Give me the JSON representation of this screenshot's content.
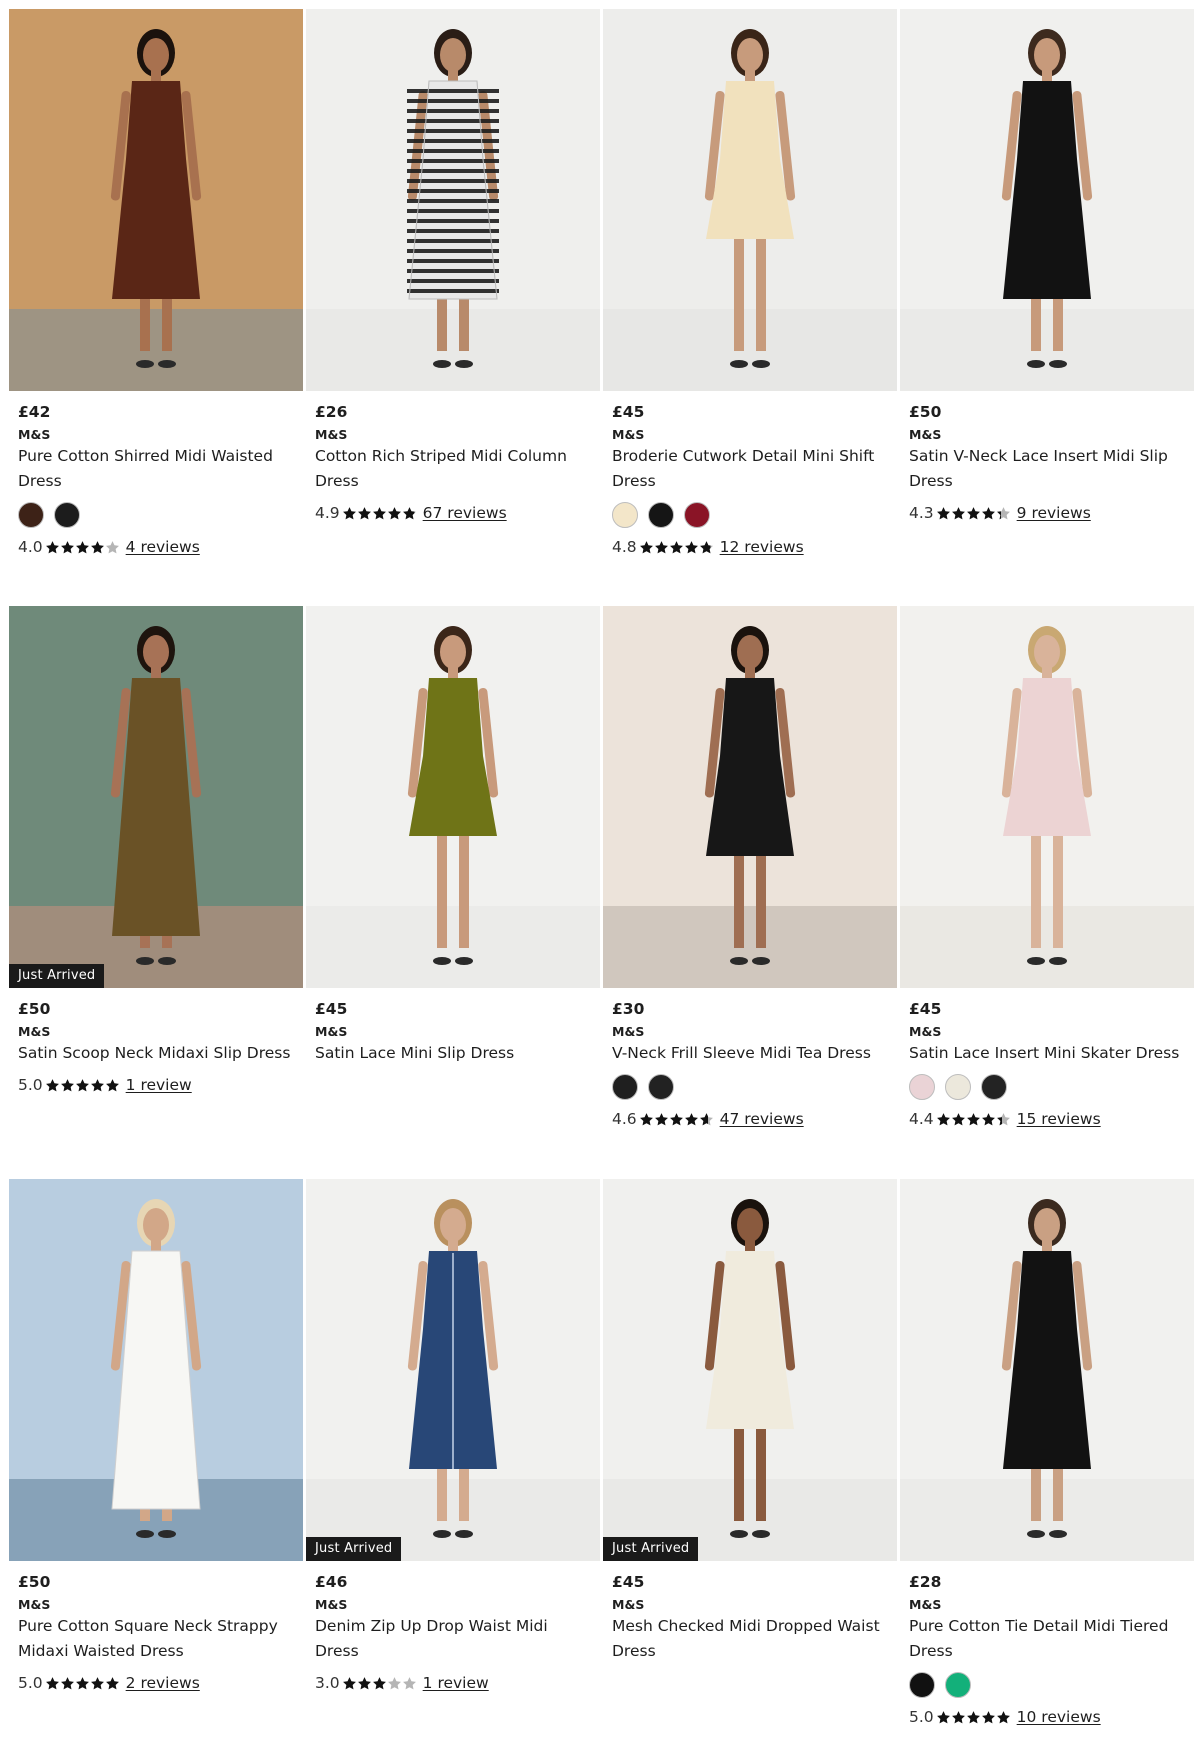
{
  "products": [
    {
      "price": "£42",
      "brand": "M&S",
      "title": "Pure Cotton Shirred Midi Waisted Dress",
      "badge": "",
      "swatches": [
        "#3d2217",
        "#1c1c1c"
      ],
      "score": "4.0",
      "rating": 4.0,
      "reviews": "4 reviews"
    },
    {
      "price": "£26",
      "brand": "M&S",
      "title": "Cotton Rich Striped Midi Column Dress",
      "badge": "",
      "swatches": [],
      "score": "4.9",
      "rating": 4.9,
      "reviews": "67 reviews"
    },
    {
      "price": "£45",
      "brand": "M&S",
      "title": "Broderie Cutwork Detail Mini Shift Dress",
      "badge": "",
      "swatches": [
        "#f3e6c9",
        "#151515",
        "#8a1426"
      ],
      "score": "4.8",
      "rating": 4.8,
      "reviews": "12 reviews"
    },
    {
      "price": "£50",
      "brand": "M&S",
      "title": "Satin V-Neck Lace Insert Midi Slip Dress",
      "badge": "",
      "swatches": [],
      "score": "4.3",
      "rating": 4.3,
      "reviews": "9 reviews"
    },
    {
      "price": "£50",
      "brand": "M&S",
      "title": "Satin Scoop Neck Midaxi Slip Dress",
      "badge": "Just Arrived",
      "swatches": [],
      "score": "5.0",
      "rating": 5.0,
      "reviews": "1 review"
    },
    {
      "price": "£45",
      "brand": "M&S",
      "title": "Satin Lace Mini Slip Dress",
      "badge": "",
      "swatches": [],
      "score": "",
      "rating": null,
      "reviews": ""
    },
    {
      "price": "£30",
      "brand": "M&S",
      "title": "V-Neck Frill Sleeve Midi Tea Dress",
      "badge": "",
      "swatches": [
        "#1f1f1f",
        "#222222"
      ],
      "score": "4.6",
      "rating": 4.6,
      "reviews": "47 reviews"
    },
    {
      "price": "£45",
      "brand": "M&S",
      "title": "Satin Lace Insert Mini Skater Dress",
      "badge": "",
      "swatches": [
        "#ead3d6",
        "#ece8dc",
        "#232323"
      ],
      "score": "4.4",
      "rating": 4.4,
      "reviews": "15 reviews"
    },
    {
      "price": "£50",
      "brand": "M&S",
      "title": "Pure Cotton Square Neck Strappy Midaxi Waisted Dress",
      "badge": "",
      "swatches": [],
      "score": "5.0",
      "rating": 5.0,
      "reviews": "2 reviews"
    },
    {
      "price": "£46",
      "brand": "M&S",
      "title": "Denim Zip Up Drop Waist Midi Dress",
      "badge": "Just Arrived",
      "swatches": [],
      "score": "3.0",
      "rating": 3.0,
      "reviews": "1 review"
    },
    {
      "price": "£45",
      "brand": "M&S",
      "title": "Mesh Checked Midi Dropped Waist Dress",
      "badge": "Just Arrived",
      "swatches": [],
      "score": "",
      "rating": null,
      "reviews": ""
    },
    {
      "price": "£28",
      "brand": "M&S",
      "title": "Pure Cotton Tie Detail Midi Tiered Dress",
      "badge": "",
      "swatches": [
        "#111111",
        "#13b07a"
      ],
      "score": "5.0",
      "rating": 5.0,
      "reviews": "10 reviews"
    }
  ],
  "photos": [
    {
      "bg": "#c99a66",
      "bg2": "#7a8f9a",
      "dress": "#5a2616",
      "skin": "#a8714f",
      "hair": "#1b120d",
      "style": "midi"
    },
    {
      "bg": "#efefed",
      "bg2": "#e4e4e2",
      "dress": "#e8e8e8",
      "skin": "#b88a6a",
      "hair": "#2a1d16",
      "style": "stripe"
    },
    {
      "bg": "#ededeb",
      "bg2": "#e2e2e0",
      "dress": "#f1e1bd",
      "skin": "#c79b7c",
      "hair": "#3a2518",
      "style": "mini"
    },
    {
      "bg": "#f0f0ee",
      "bg2": "#e5e5e3",
      "dress": "#121212",
      "skin": "#c79a7b",
      "hair": "#3d2a1e",
      "style": "midi"
    },
    {
      "bg": "#6f8a7a",
      "bg2": "#c98f7d",
      "dress": "#6a5226",
      "skin": "#a77256",
      "hair": "#1e140e",
      "style": "maxi"
    },
    {
      "bg": "#f1f1ef",
      "bg2": "#e6e6e4",
      "dress": "#6f7417",
      "skin": "#c89a7c",
      "hair": "#3b2619",
      "style": "mini"
    },
    {
      "bg": "#ece3da",
      "bg2": "#b9b1a8",
      "dress": "#171717",
      "skin": "#9f6e52",
      "hair": "#1a120d",
      "style": "seated"
    },
    {
      "bg": "#f2f1ee",
      "bg2": "#e3e0da",
      "dress": "#ecd3d3",
      "skin": "#d9b39a",
      "hair": "#c9a872",
      "style": "mini"
    },
    {
      "bg": "#b8cde0",
      "bg2": "#5f7f98",
      "dress": "#f7f7f4",
      "skin": "#d2a788",
      "hair": "#e7d6b4",
      "style": "maxi"
    },
    {
      "bg": "#f1f1ef",
      "bg2": "#e4e4e2",
      "dress": "#284777",
      "skin": "#d4ab8f",
      "hair": "#b9905e",
      "style": "denim"
    },
    {
      "bg": "#f0f0ee",
      "bg2": "#e3e3e1",
      "dress": "#f0ebdd",
      "skin": "#8a5a3e",
      "hair": "#1a120d",
      "style": "seated"
    },
    {
      "bg": "#f1f1ef",
      "bg2": "#e5e5e3",
      "dress": "#121212",
      "skin": "#c9a083",
      "hair": "#3b2a1f",
      "style": "midi"
    }
  ]
}
